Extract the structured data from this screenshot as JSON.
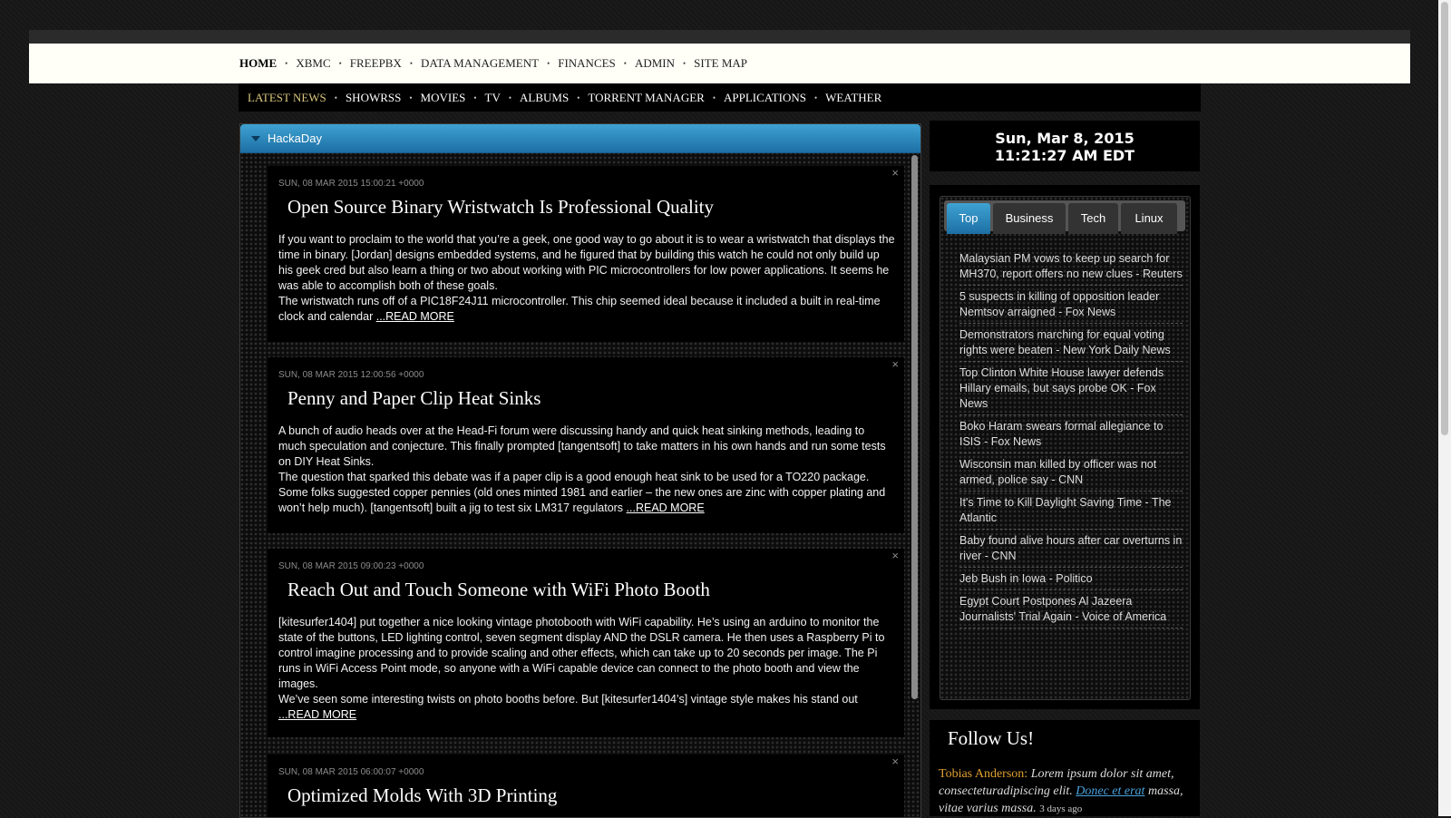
{
  "main_nav": {
    "items": [
      {
        "label": "HOME"
      },
      {
        "label": "XBMC"
      },
      {
        "label": "FREEPBX"
      },
      {
        "label": "DATA MANAGEMENT"
      },
      {
        "label": "FINANCES"
      },
      {
        "label": "ADMIN"
      },
      {
        "label": "SITE MAP"
      }
    ],
    "separator": "•"
  },
  "sub_nav": {
    "items": [
      {
        "label": "LATEST NEWS"
      },
      {
        "label": "SHOWRSS"
      },
      {
        "label": "MOVIES"
      },
      {
        "label": "TV"
      },
      {
        "label": "ALBUMS"
      },
      {
        "label": "TORRENT MANAGER"
      },
      {
        "label": "APPLICATIONS"
      },
      {
        "label": "WEATHER"
      }
    ],
    "separator": "•"
  },
  "feed": {
    "title": "HackaDay",
    "close_glyph": "×",
    "read_more": "...READ MORE",
    "articles": [
      {
        "date": "SUN, 08 MAR 2015 15:00:21 +0000",
        "title": "Open Source Binary Wristwatch Is Professional Quality",
        "p1": "If you want to proclaim to the world that you’re a geek, one good way to go about it is to wear a wristwatch that displays the time in binary. [Jordan] designs embedded systems, and he figured that by building this watch he could not only build up his geek cred but also learn a thing or two about working with PIC microcontrollers for low power applications. It seems he was able to accomplish both of these goals.",
        "p2": "The wristwatch runs off of a PIC18F24J11 microcontroller. This chip seemed ideal because it included a built in real-time clock and calendar"
      },
      {
        "date": "SUN, 08 MAR 2015 12:00:56 +0000",
        "title": "Penny and Paper Clip Heat Sinks",
        "p1": "A bunch of audio heads over at the Head-Fi forum were discussing handy and quick heat sinking methods, leading to much speculation and conjecture. This finally prompted [tangentsoft] to take matters in his own hands and run some tests on DIY Heat Sinks.",
        "p2": "The question that sparked this debate was if a paper clip is a good enough heat sink to be used for a TO220 package. Some folks suggested copper pennies (old ones minted 1981 and earlier – the new ones are zinc with copper plating and won’t help much). [tangentsoft] built a jig to test six LM317 regulators"
      },
      {
        "date": "SUN, 08 MAR 2015 09:00:23 +0000",
        "title": "Reach Out and Touch Someone with WiFi Photo Booth",
        "p1": "[kitesurfer1404] put together a nice looking vintage photobooth with WiFi capability. He’s using an arduino to monitor the state of the buttons, LED lighting control, seven segment display AND the DSLR camera. He then uses a Raspberry Pi to control imagine processing and to provide scaling and other effects, which can take up to 20 seconds per image. The Pi runs in WiFi Access Point mode, so anyone with a WiFi capable device can connect to the photo booth and view the images.",
        "p2": "We’ve seen some interesting twists on photo booths before. But [kitesurfer1404’s] vintage style makes his stand out"
      },
      {
        "date": "SUN, 08 MAR 2015 06:00:07 +0000",
        "title": "Optimized Molds With 3D Printing",
        "p1": "",
        "p2": ""
      }
    ]
  },
  "clock": {
    "date": "Sun, Mar 8, 2015",
    "time": "11:21:27 AM EDT"
  },
  "news": {
    "tabs": [
      {
        "label": "Top",
        "active": true
      },
      {
        "label": "Business",
        "active": false
      },
      {
        "label": "Tech",
        "active": false
      },
      {
        "label": "Linux",
        "active": false
      }
    ],
    "items": [
      "Malaysian PM vows to keep up search for MH370, report offers no new clues - Reuters",
      "5 suspects in killing of opposition leader Nemtsov arraigned - Fox News",
      "Demonstrators marching for equal voting rights were beaten - New York Daily News",
      "Top Clinton White House lawyer defends Hillary emails, but says probe OK - Fox News",
      "Boko Haram swears formal allegiance to ISIS - Fox News",
      "Wisconsin man killed by officer was not armed, police say - CNN",
      "It's Time to Kill Daylight Saving Time - The Atlantic",
      "Baby found alive hours after car overturns in river - CNN",
      "Jeb Bush in Iowa - Politico",
      "Egypt Court Postpones Al Jazeera Journalists' Trial Again - Voice of America"
    ]
  },
  "follow": {
    "heading": "Follow Us!",
    "author": "Tobias Anderson:",
    "text1": "Lorem ipsum dolor sit amet, consecteturadipiscing elit.",
    "link": "Donec et erat",
    "text2": "massa, vitae varius massa.",
    "time": "3 days ago"
  }
}
